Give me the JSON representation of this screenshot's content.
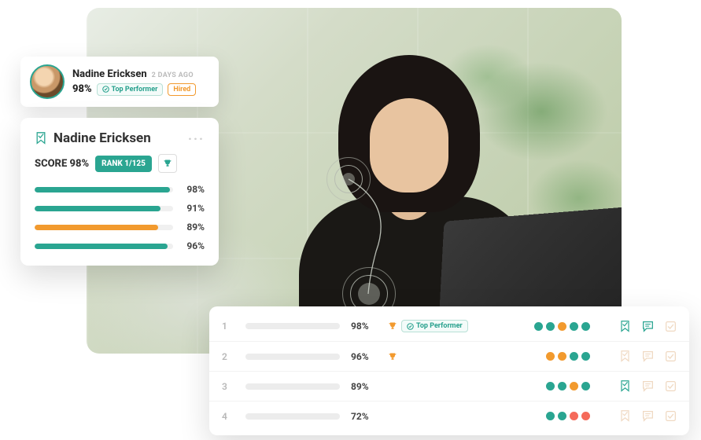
{
  "colors": {
    "teal": "#2aa591",
    "orange": "#f29a2e",
    "coral": "#f56a5a"
  },
  "profile": {
    "name": "Nadine Ericksen",
    "age_label": "2 DAYS AGO",
    "percent": "98%",
    "top_performer_label": "Top Performer",
    "hired_label": "Hired"
  },
  "score": {
    "name": "Nadine Ericksen",
    "score_label": "SCORE 98%",
    "rank_label": "RANK 1/125",
    "bars": [
      {
        "pct": 98,
        "pct_label": "98%",
        "color": "#2aa591"
      },
      {
        "pct": 91,
        "pct_label": "91%",
        "color": "#2aa591"
      },
      {
        "pct": 89,
        "pct_label": "89%",
        "color": "#f29a2e"
      },
      {
        "pct": 96,
        "pct_label": "96%",
        "color": "#2aa591"
      }
    ]
  },
  "table": {
    "top_performer_label": "Top Performer",
    "rows": [
      {
        "rank": "1",
        "pct": "98%",
        "trophy": true,
        "top_performer": true,
        "dots": [
          "#2aa591",
          "#2aa591",
          "#f29a2e",
          "#2aa591",
          "#2aa591"
        ],
        "icons": {
          "bookmark": true,
          "comment": true,
          "check": false
        }
      },
      {
        "rank": "2",
        "pct": "96%",
        "trophy": true,
        "top_performer": false,
        "dots": [
          "#f29a2e",
          "#f29a2e",
          "#2aa591",
          "#2aa591"
        ],
        "icons": {
          "bookmark": false,
          "comment": false,
          "check": false
        }
      },
      {
        "rank": "3",
        "pct": "89%",
        "trophy": false,
        "top_performer": false,
        "dots": [
          "#2aa591",
          "#2aa591",
          "#f29a2e",
          "#2aa591"
        ],
        "icons": {
          "bookmark": true,
          "comment": false,
          "check": false
        }
      },
      {
        "rank": "4",
        "pct": "72%",
        "trophy": false,
        "top_performer": false,
        "dots": [
          "#2aa591",
          "#2aa591",
          "#f56a5a",
          "#f56a5a"
        ],
        "icons": {
          "bookmark": false,
          "comment": false,
          "check": false
        }
      }
    ]
  }
}
